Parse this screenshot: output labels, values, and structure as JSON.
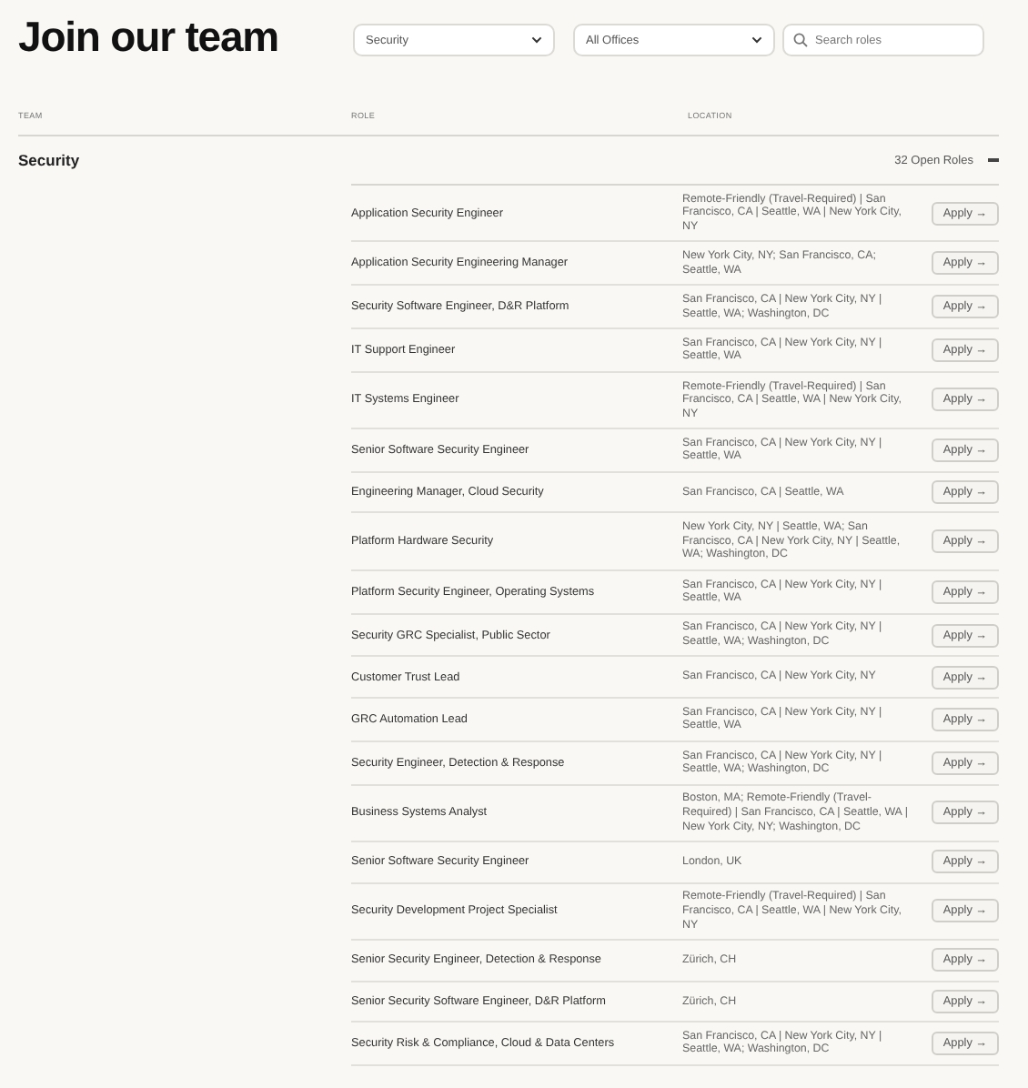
{
  "title": "Join our team",
  "filters": [
    {
      "kind": "select",
      "value": "Security"
    },
    {
      "kind": "select",
      "value": "All Offices"
    },
    {
      "kind": "search",
      "placeholder": "Search roles"
    }
  ],
  "columns": [
    "TEAM",
    "ROLE",
    "LOCATION"
  ],
  "group": {
    "name": "Security",
    "count": "32 Open Roles",
    "expanded": true
  },
  "jobs": [
    {
      "role": "Application Security Engineer",
      "location": "Remote-Friendly (Travel-Required) | San Francisco, CA | Seattle, WA | New York City, NY",
      "action": "Apply →"
    },
    {
      "role": "Application Security Engineering Manager",
      "location": "New York City, NY; San Francisco, CA; Seattle, WA",
      "action": "Apply →"
    },
    {
      "role": "Security Software Engineer, D&R Platform",
      "location": "San Francisco, CA | New York City, NY | Seattle, WA; Washington, DC",
      "action": "Apply →"
    },
    {
      "role": "IT Support Engineer",
      "location": "San Francisco, CA | New York City, NY | Seattle, WA",
      "action": "Apply →"
    },
    {
      "role": "IT Systems Engineer",
      "location": "Remote-Friendly (Travel-Required) | San Francisco, CA | Seattle, WA | New York City, NY",
      "action": "Apply →"
    },
    {
      "role": "Senior Software Security Engineer",
      "location": "San Francisco, CA | New York City, NY | Seattle, WA",
      "action": "Apply →"
    },
    {
      "role": "Engineering Manager, Cloud Security",
      "location": "San Francisco, CA | Seattle, WA",
      "action": "Apply →"
    },
    {
      "role": "Platform Hardware Security",
      "location": "New York City, NY | Seattle, WA; San Francisco, CA | New York City, NY | Seattle, WA; Washington, DC",
      "action": "Apply →"
    },
    {
      "role": "Platform Security Engineer, Operating Systems",
      "location": "San Francisco, CA | New York City, NY | Seattle, WA",
      "action": "Apply →"
    },
    {
      "role": "Security GRC Specialist, Public Sector",
      "location": "San Francisco, CA | New York City, NY | Seattle, WA; Washington, DC",
      "action": "Apply →"
    },
    {
      "role": "Customer Trust Lead",
      "location": "San Francisco, CA | New York City, NY",
      "action": "Apply →"
    },
    {
      "role": "GRC Automation Lead",
      "location": "San Francisco, CA | New York City, NY | Seattle, WA",
      "action": "Apply →"
    },
    {
      "role": "Security Engineer, Detection & Response",
      "location": "San Francisco, CA | New York City, NY | Seattle, WA; Washington, DC",
      "action": "Apply →"
    },
    {
      "role": "Business Systems Analyst",
      "location": "Boston, MA; Remote-Friendly (Travel-Required) | San Francisco, CA | Seattle, WA | New York City, NY; Washington, DC",
      "action": "Apply →"
    },
    {
      "role": "Senior Software Security Engineer",
      "location": "London, UK",
      "action": "Apply →"
    },
    {
      "role": "Security Development Project Specialist",
      "location": "Remote-Friendly (Travel-Required) | San Francisco, CA | Seattle, WA | New York City, NY",
      "action": "Apply →"
    },
    {
      "role": "Senior Security Engineer, Detection & Response",
      "location": "Zürich, CH",
      "action": "Apply →"
    },
    {
      "role": "Senior Security Software Engineer, D&R Platform",
      "location": "Zürich, CH",
      "action": "Apply →"
    },
    {
      "role": "Security Risk & Compliance, Cloud & Data Centers",
      "location": "San Francisco, CA | New York City, NY | Seattle, WA; Washington, DC",
      "action": "Apply →"
    }
  ]
}
